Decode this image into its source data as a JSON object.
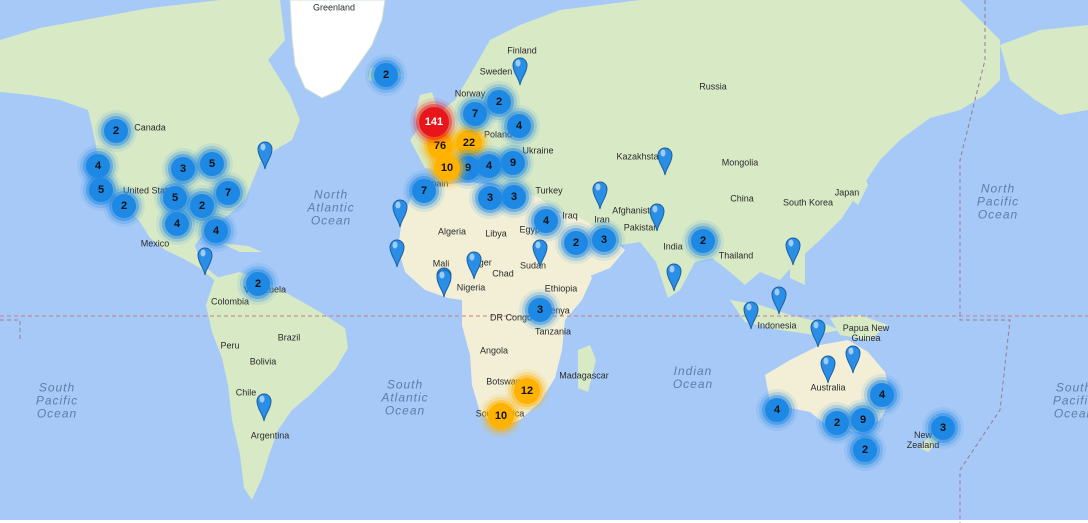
{
  "map": {
    "colors": {
      "water": "#a6c9f7",
      "land": "#d8e9c6",
      "desert": "#f2efd6",
      "ice": "#ffffff",
      "cluster_small": "#1e88e5",
      "cluster_medium": "#ffb300",
      "cluster_large": "#e8161b",
      "pin": "#2a8ee6"
    },
    "oceans": [
      {
        "id": "north-atlantic",
        "line1": "North",
        "line2": "Atlantic",
        "line3": "Ocean"
      },
      {
        "id": "south-atlantic",
        "line1": "South",
        "line2": "Atlantic",
        "line3": "Ocean"
      },
      {
        "id": "north-pacific",
        "line1": "North",
        "line2": "Pacific",
        "line3": "Ocean"
      },
      {
        "id": "south-pacific-west",
        "line1": "South",
        "line2": "Pacific",
        "line3": "Ocean"
      },
      {
        "id": "south-pacific-east",
        "line1": "South",
        "line2": "Pacific",
        "line3": "Ocean"
      },
      {
        "id": "indian",
        "line1": "Indian",
        "line2": "Ocean",
        "line3": ""
      }
    ],
    "labels": [
      "Greenland",
      "Canada",
      "United States",
      "Mexico",
      "Colombia",
      "Venezuela",
      "Peru",
      "Brazil",
      "Bolivia",
      "Chile",
      "Argentina",
      "Finland",
      "Sweden",
      "Norway",
      "Poland",
      "Ukraine",
      "Spain",
      "Turkey",
      "Russia",
      "Kazakhstan",
      "Mongolia",
      "China",
      "South Korea",
      "Japan",
      "Iraq",
      "Iran",
      "Afghanistan",
      "Pakistan",
      "India",
      "Thailand",
      "Egypt",
      "Libya",
      "Algeria",
      "Mali",
      "Niger",
      "Chad",
      "Nigeria",
      "Sudan",
      "Ethiopia",
      "Kenya",
      "DR Congo",
      "Tanzania",
      "Angola",
      "Botswana",
      "South Africa",
      "Madagascar",
      "Indonesia",
      "Papua New Guinea",
      "Australia",
      "New Zealand"
    ],
    "clusters": [
      {
        "id": "iceland",
        "count": "2",
        "tier": "blue"
      },
      {
        "id": "canada-west",
        "count": "2",
        "tier": "blue"
      },
      {
        "id": "us-northwest",
        "count": "4",
        "tier": "blue"
      },
      {
        "id": "us-west",
        "count": "5",
        "tier": "blue"
      },
      {
        "id": "us-southwest",
        "count": "2",
        "tier": "blue"
      },
      {
        "id": "us-central-north",
        "count": "3",
        "tier": "blue"
      },
      {
        "id": "us-midwest",
        "count": "5",
        "tier": "blue"
      },
      {
        "id": "us-central",
        "count": "5",
        "tier": "blue"
      },
      {
        "id": "us-south-central",
        "count": "2",
        "tier": "blue"
      },
      {
        "id": "us-east",
        "count": "7",
        "tier": "blue"
      },
      {
        "id": "us-texas",
        "count": "4",
        "tier": "blue"
      },
      {
        "id": "us-southeast",
        "count": "4",
        "tier": "blue"
      },
      {
        "id": "venezuela",
        "count": "2",
        "tier": "blue"
      },
      {
        "id": "uk-ireland",
        "count": "141",
        "tier": "red"
      },
      {
        "id": "norway",
        "count": "7",
        "tier": "blue"
      },
      {
        "id": "sweden-baltic",
        "count": "2",
        "tier": "blue"
      },
      {
        "id": "belarus",
        "count": "4",
        "tier": "blue"
      },
      {
        "id": "western-europe",
        "count": "76",
        "tier": "yellow"
      },
      {
        "id": "central-europe",
        "count": "22",
        "tier": "yellow"
      },
      {
        "id": "france-spain",
        "count": "10",
        "tier": "yellow"
      },
      {
        "id": "italy",
        "count": "9",
        "tier": "blue"
      },
      {
        "id": "balkans",
        "count": "4",
        "tier": "blue"
      },
      {
        "id": "ukraine",
        "count": "9",
        "tier": "blue"
      },
      {
        "id": "portugal",
        "count": "7",
        "tier": "blue"
      },
      {
        "id": "greece",
        "count": "3",
        "tier": "blue"
      },
      {
        "id": "turkey",
        "count": "3",
        "tier": "blue"
      },
      {
        "id": "egypt",
        "count": "4",
        "tier": "blue"
      },
      {
        "id": "saudi",
        "count": "2",
        "tier": "blue"
      },
      {
        "id": "gulf",
        "count": "3",
        "tier": "blue"
      },
      {
        "id": "east-africa",
        "count": "3",
        "tier": "blue"
      },
      {
        "id": "south-africa-north",
        "count": "12",
        "tier": "yellow"
      },
      {
        "id": "south-africa",
        "count": "10",
        "tier": "yellow"
      },
      {
        "id": "bangladesh",
        "count": "2",
        "tier": "blue"
      },
      {
        "id": "australia-west",
        "count": "4",
        "tier": "blue"
      },
      {
        "id": "australia-east",
        "count": "4",
        "tier": "blue"
      },
      {
        "id": "australia-south",
        "count": "2",
        "tier": "blue"
      },
      {
        "id": "australia-southeast",
        "count": "9",
        "tier": "blue"
      },
      {
        "id": "tasmania",
        "count": "2",
        "tier": "blue"
      },
      {
        "id": "new-zealand",
        "count": "3",
        "tier": "blue"
      }
    ],
    "pins": [
      "us-northeast",
      "mexico-south",
      "chile-argentina",
      "canary-islands",
      "west-africa-coast",
      "morocco",
      "nigeria",
      "niger",
      "sudan",
      "finland",
      "kazakhstan",
      "iran",
      "pakistan",
      "india-south",
      "philippines",
      "indonesia-west",
      "indonesia-east",
      "new-guinea",
      "australia-north",
      "australia-northeast"
    ]
  }
}
